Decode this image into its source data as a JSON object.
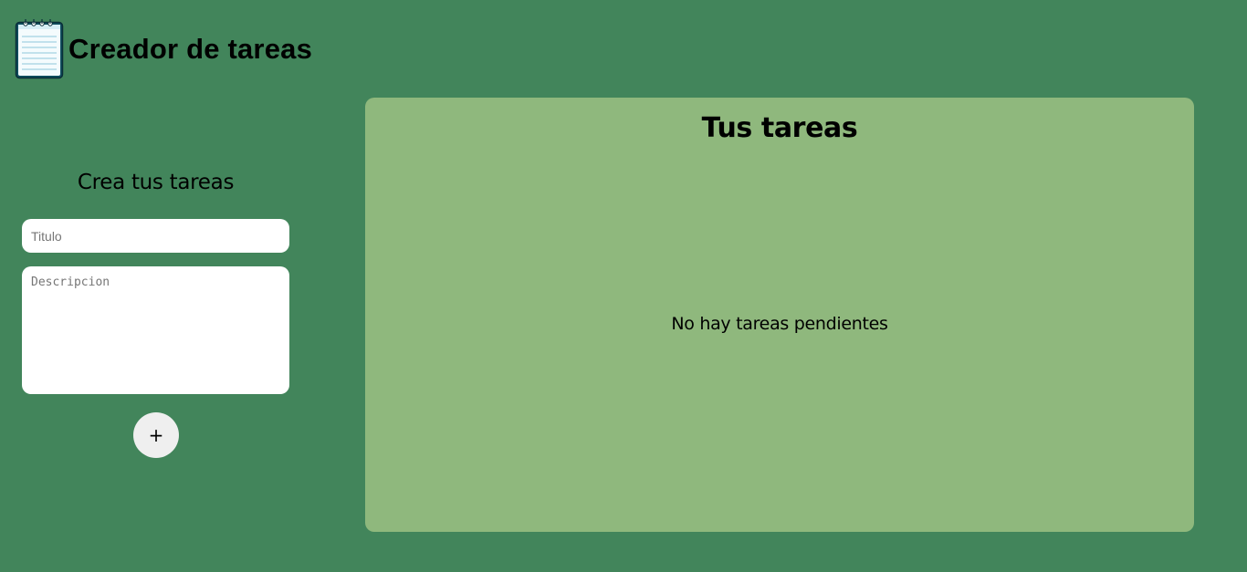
{
  "header": {
    "icon": "notepad-icon",
    "title": "Creador de tareas"
  },
  "create_panel": {
    "title": "Crea tus tareas",
    "title_input": {
      "placeholder": "Titulo",
      "value": ""
    },
    "description_input": {
      "placeholder": "Descripcion",
      "value": ""
    },
    "add_button_label": "+"
  },
  "tasks_panel": {
    "title": "Tus tareas",
    "empty_message": "No hay tareas pendientes"
  },
  "colors": {
    "background": "#42855b",
    "tasks_panel_background": "#8fb87d",
    "input_background": "#ffffff",
    "add_button_background": "#efefef"
  }
}
